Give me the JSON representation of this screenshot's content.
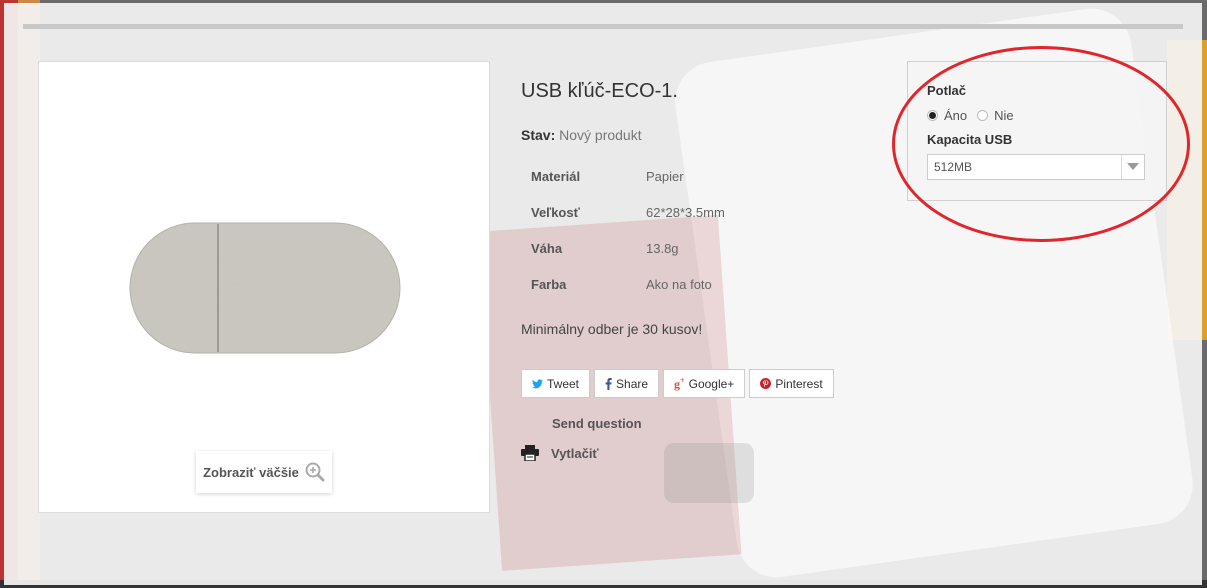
{
  "product": {
    "title": "USB kľúč-ECO-1.",
    "condition_label": "Stav:",
    "condition_value": "Nový produkt",
    "attributes": [
      {
        "name": "Materiál",
        "value": "Papier"
      },
      {
        "name": "Veľkosť",
        "value": "62*28*3.5mm"
      },
      {
        "name": "Váha",
        "value": "13.8g"
      },
      {
        "name": "Farba",
        "value": "Ako na foto"
      }
    ],
    "minimum_order": "Minimálny odber je 30 kusov!"
  },
  "image": {
    "zoom_label": "Zobraziť väčšie"
  },
  "social": {
    "tweet": "Tweet",
    "share": "Share",
    "google": "Google+",
    "pinterest": "Pinterest"
  },
  "actions": {
    "send_question": "Send question",
    "print": "Vytlačiť"
  },
  "options": {
    "print_label": "Potlač",
    "print_yes": "Áno",
    "print_no": "Nie",
    "print_selected": "Áno",
    "capacity_label": "Kapacita USB",
    "capacity_selected": "512MB"
  },
  "colors": {
    "twitter": "#1da1f2",
    "facebook": "#3b5998",
    "google": "#dd4b39",
    "pinterest": "#cb2027",
    "annotation": "#e0262c"
  },
  "icons": {
    "zoom": "zoom-in-icon",
    "twitter": "twitter-icon",
    "facebook": "facebook-icon",
    "google": "google-plus-icon",
    "pinterest": "pinterest-icon",
    "print": "printer-icon",
    "dropdown": "chevron-down-icon"
  }
}
